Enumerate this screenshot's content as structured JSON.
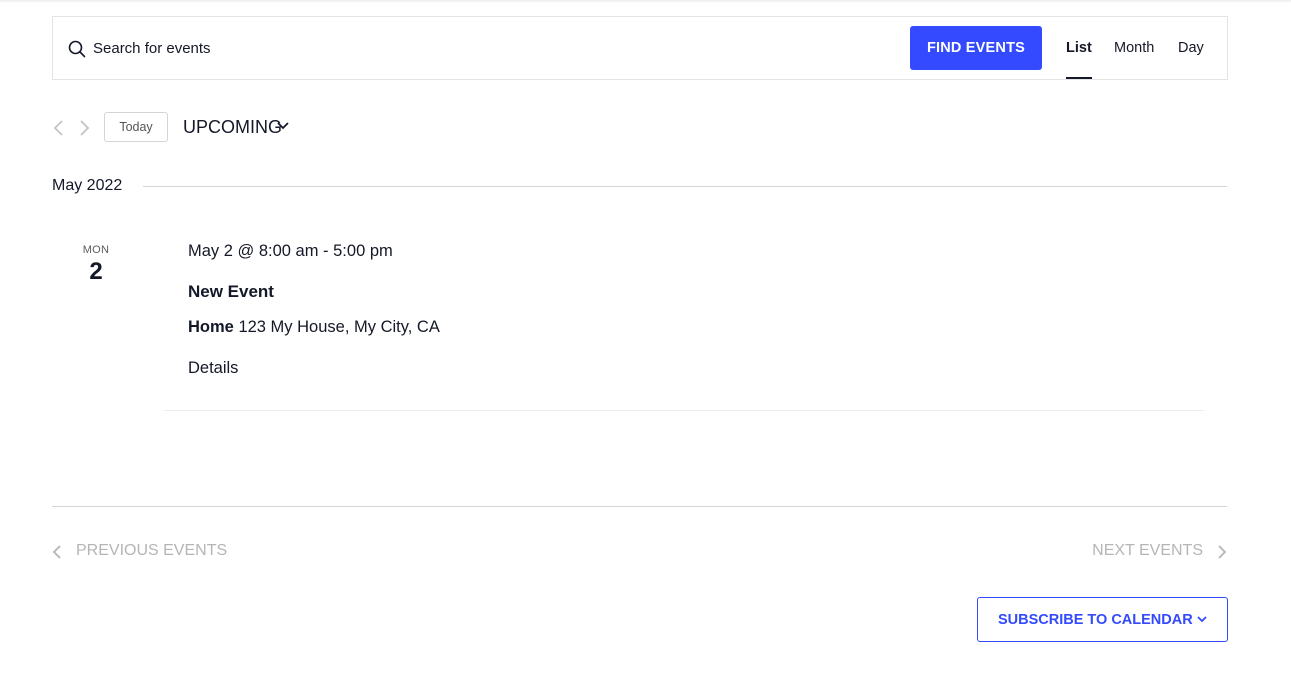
{
  "search": {
    "placeholder": "Search for events",
    "value": "",
    "button_label": "FIND EVENTS"
  },
  "views": [
    {
      "label": "List",
      "active": true
    },
    {
      "label": "Month",
      "active": false
    },
    {
      "label": "Day",
      "active": false
    }
  ],
  "nav": {
    "today_label": "Today",
    "range_label": "UPCOMING"
  },
  "month_label": "May 2022",
  "event": {
    "day_of_week": "MON",
    "day": "2",
    "time": "May 2 @ 8:00 am - 5:00 pm",
    "title": "New Event",
    "venue_name": "Home",
    "venue_address": "123 My House, My City, CA",
    "details_label": "Details"
  },
  "pagination": {
    "previous_label": "PREVIOUS EVENTS",
    "next_label": "NEXT EVENTS"
  },
  "subscribe_label": "SUBSCRIBE TO CALENDAR",
  "colors": {
    "accent": "#334aff",
    "text": "#141827",
    "muted": "#b5b5b5",
    "border": "#d5d5d5"
  }
}
